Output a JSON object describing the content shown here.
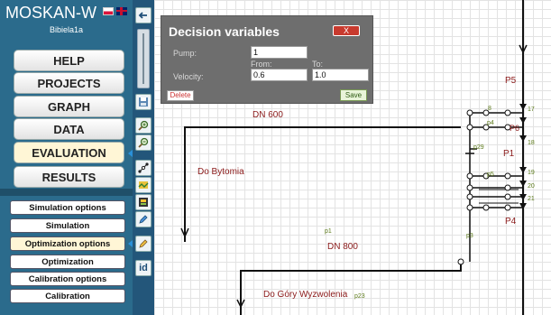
{
  "app": {
    "title": "MOSKAN-W",
    "user": "Bibiela1a"
  },
  "languages": [
    "polish-flag-icon",
    "uk-flag-icon"
  ],
  "main_menu": [
    {
      "label": "HELP",
      "active": false
    },
    {
      "label": "PROJECTS",
      "active": false
    },
    {
      "label": "GRAPH",
      "active": false
    },
    {
      "label": "DATA",
      "active": false
    },
    {
      "label": "EVALUATION",
      "active": true
    },
    {
      "label": "RESULTS",
      "active": false
    }
  ],
  "sub_menu": [
    {
      "label": "Simulation options",
      "active": false
    },
    {
      "label": "Simulation",
      "active": false
    },
    {
      "label": "Optimization options",
      "active": true
    },
    {
      "label": "Optimization",
      "active": false
    },
    {
      "label": "Calibration options",
      "active": false
    },
    {
      "label": "Calibration",
      "active": false
    }
  ],
  "toolbar": {
    "id_label": "id",
    "icons": [
      "back-arrow-icon",
      "zoom-slider",
      "save-icon",
      "zoom-in-icon",
      "zoom-out-icon",
      "connect-nodes-icon",
      "map-icon",
      "layers-icon",
      "edit-icon",
      "pencil-icon",
      "node-id-icon"
    ]
  },
  "dialog": {
    "title": "Decision variables",
    "close_label": "X",
    "pump_label": "Pump:",
    "pump_value": "1",
    "velocity_label": "Velocity:",
    "from_label": "From:",
    "to_label": "To:",
    "from_value": "0.6",
    "to_value": "1.0",
    "delete_label": "Delete",
    "save_label": "Save"
  },
  "canvas": {
    "labels": {
      "dn600": "DN 600",
      "dn800": "DN 800",
      "bytom": "Do Bytomia",
      "gory": "Do Góry Wyzwolenia",
      "p5": "P5",
      "p1": "P1",
      "p4": "P4"
    },
    "node_labels": {
      "p1": "p1",
      "p23": "p23",
      "p29": "p29",
      "p3": "p3",
      "p4": "p4",
      "p5": "p5",
      "p6": "P6",
      "n8": "8",
      "n17": "17",
      "n18": "18",
      "n19": "19",
      "n20": "20",
      "n21": "21"
    }
  }
}
